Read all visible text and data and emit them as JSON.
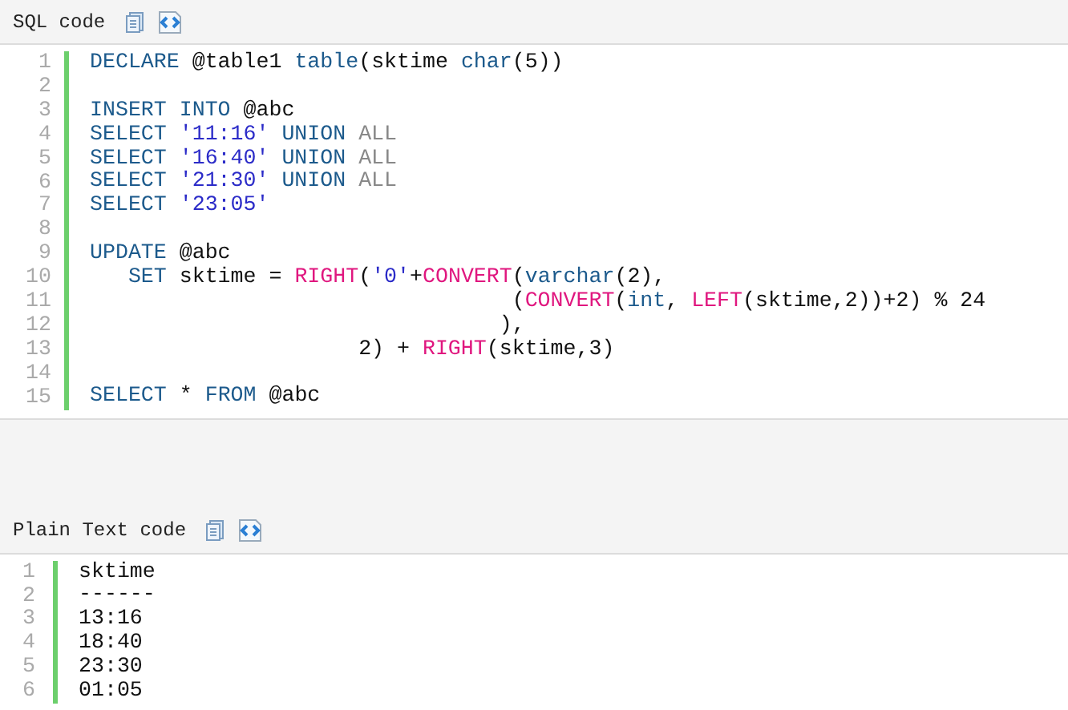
{
  "blocks": [
    {
      "title": "SQL code",
      "lines": [
        {
          "number": "1",
          "code": [
            {
              "text": "DECLARE",
              "kind": "keyword"
            },
            {
              "text": " @table1 ",
              "kind": "plain"
            },
            {
              "text": "table",
              "kind": "keyword"
            },
            {
              "text": "(sktime ",
              "kind": "plain"
            },
            {
              "text": "char",
              "kind": "keyword"
            },
            {
              "text": "(5))",
              "kind": "plain"
            }
          ]
        },
        {
          "number": "2"
        },
        {
          "number": "3",
          "code": [
            {
              "text": "INSERT INTO",
              "kind": "keyword"
            },
            {
              "text": " @abc",
              "kind": "plain"
            }
          ]
        },
        {
          "number": "4",
          "code": [
            {
              "text": "SELECT ",
              "kind": "keyword"
            },
            {
              "text": "'11:16'",
              "kind": "string"
            },
            {
              "text": " UNION ",
              "kind": "keyword"
            },
            {
              "text": "ALL",
              "kind": "operator"
            }
          ]
        },
        {
          "number": "5",
          "code": [
            {
              "text": "SELECT ",
              "kind": "keyword"
            },
            {
              "text": "'16:40'",
              "kind": "string"
            },
            {
              "text": " UNION ",
              "kind": "keyword"
            },
            {
              "text": "ALL",
              "kind": "operator"
            }
          ]
        },
        {
          "number": "6",
          "code": [
            {
              "text": "SELECT ",
              "kind": "keyword"
            },
            {
              "text": "'21:30'",
              "kind": "string"
            },
            {
              "text": " UNION ",
              "kind": "keyword"
            },
            {
              "text": "ALL",
              "kind": "operator"
            }
          ]
        },
        {
          "number": "7",
          "code": [
            {
              "text": "SELECT ",
              "kind": "keyword"
            },
            {
              "text": "'23:05'",
              "kind": "string"
            }
          ]
        },
        {
          "number": "8"
        },
        {
          "number": "9",
          "code": [
            {
              "text": "UPDATE",
              "kind": "keyword"
            },
            {
              "text": " @abc",
              "kind": "plain"
            }
          ]
        },
        {
          "number": "10",
          "code": [
            {
              "text": "   SET",
              "kind": "keyword"
            },
            {
              "text": " sktime = ",
              "kind": "plain"
            },
            {
              "text": "RIGHT",
              "kind": "function"
            },
            {
              "text": "(",
              "kind": "plain"
            },
            {
              "text": "'0'",
              "kind": "string"
            },
            {
              "text": "+",
              "kind": "plain"
            },
            {
              "text": "CONVERT",
              "kind": "function"
            },
            {
              "text": "(",
              "kind": "plain"
            },
            {
              "text": "varchar",
              "kind": "keyword"
            },
            {
              "text": "(2),",
              "kind": "plain"
            }
          ]
        },
        {
          "number": "11",
          "code": [
            {
              "text": "                                 (",
              "kind": "plain"
            },
            {
              "text": "CONVERT",
              "kind": "function"
            },
            {
              "text": "(",
              "kind": "plain"
            },
            {
              "text": "int",
              "kind": "keyword"
            },
            {
              "text": ", ",
              "kind": "plain"
            },
            {
              "text": "LEFT",
              "kind": "function"
            },
            {
              "text": "(sktime,2))+2) % 24",
              "kind": "plain"
            }
          ]
        },
        {
          "number": "12",
          "code": [
            {
              "text": "                                ),",
              "kind": "plain"
            }
          ]
        },
        {
          "number": "13",
          "code": [
            {
              "text": "                     2) + ",
              "kind": "plain"
            },
            {
              "text": "RIGHT",
              "kind": "function"
            },
            {
              "text": "(sktime,3)",
              "kind": "plain"
            }
          ]
        },
        {
          "number": "14"
        },
        {
          "number": "15",
          "code": [
            {
              "text": "SELECT",
              "kind": "keyword"
            },
            {
              "text": " * ",
              "kind": "plain"
            },
            {
              "text": "FROM",
              "kind": "keyword"
            },
            {
              "text": " @abc",
              "kind": "plain"
            }
          ]
        }
      ]
    },
    {
      "title": "Plain Text code",
      "lines": [
        {
          "number": "1",
          "code": [
            {
              "text": "sktime",
              "kind": "plain"
            }
          ]
        },
        {
          "number": "2",
          "code": [
            {
              "text": "------",
              "kind": "plain"
            }
          ]
        },
        {
          "number": "3",
          "code": [
            {
              "text": "13:16",
              "kind": "plain"
            }
          ]
        },
        {
          "number": "4",
          "code": [
            {
              "text": "18:40",
              "kind": "plain"
            }
          ]
        },
        {
          "number": "5",
          "code": [
            {
              "text": "23:30",
              "kind": "plain"
            }
          ]
        },
        {
          "number": "6",
          "code": [
            {
              "text": "01:05",
              "kind": "plain"
            }
          ]
        }
      ]
    }
  ]
}
